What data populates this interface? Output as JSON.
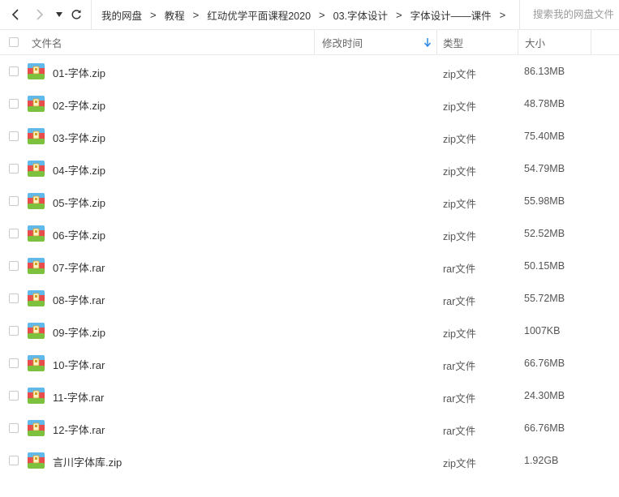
{
  "toolbar": {
    "breadcrumbs": [
      "我的网盘",
      "教程",
      "红动优学平面课程2020",
      "03.字体设计",
      "字体设计——课件"
    ],
    "separator": ">",
    "search_placeholder": "搜索我的网盘文件"
  },
  "columns": {
    "name": "文件名",
    "modified": "修改时间",
    "type": "类型",
    "size": "大小"
  },
  "colors": {
    "accent": "#2b8ae6",
    "archive_icon_top": "#62b8e8",
    "archive_icon_mid": "#e84c4c",
    "archive_icon_bottom": "#7cc23f"
  },
  "files": [
    {
      "name": "01-字体.zip",
      "type": "zip文件",
      "size": "86.13MB",
      "icon": "archive-icon"
    },
    {
      "name": "02-字体.zip",
      "type": "zip文件",
      "size": "48.78MB",
      "icon": "archive-icon"
    },
    {
      "name": "03-字体.zip",
      "type": "zip文件",
      "size": "75.40MB",
      "icon": "archive-icon"
    },
    {
      "name": "04-字体.zip",
      "type": "zip文件",
      "size": "54.79MB",
      "icon": "archive-icon"
    },
    {
      "name": "05-字体.zip",
      "type": "zip文件",
      "size": "55.98MB",
      "icon": "archive-icon"
    },
    {
      "name": "06-字体.zip",
      "type": "zip文件",
      "size": "52.52MB",
      "icon": "archive-icon"
    },
    {
      "name": "07-字体.rar",
      "type": "rar文件",
      "size": "50.15MB",
      "icon": "archive-icon"
    },
    {
      "name": "08-字体.rar",
      "type": "rar文件",
      "size": "55.72MB",
      "icon": "archive-icon"
    },
    {
      "name": "09-字体.zip",
      "type": "zip文件",
      "size": "1007KB",
      "icon": "archive-icon"
    },
    {
      "name": "10-字体.rar",
      "type": "rar文件",
      "size": "66.76MB",
      "icon": "archive-icon"
    },
    {
      "name": "11-字体.rar",
      "type": "rar文件",
      "size": "24.30MB",
      "icon": "archive-icon"
    },
    {
      "name": "12-字体.rar",
      "type": "rar文件",
      "size": "66.76MB",
      "icon": "archive-icon"
    },
    {
      "name": "言川字体库.zip",
      "type": "zip文件",
      "size": "1.92GB",
      "icon": "archive-icon"
    }
  ]
}
